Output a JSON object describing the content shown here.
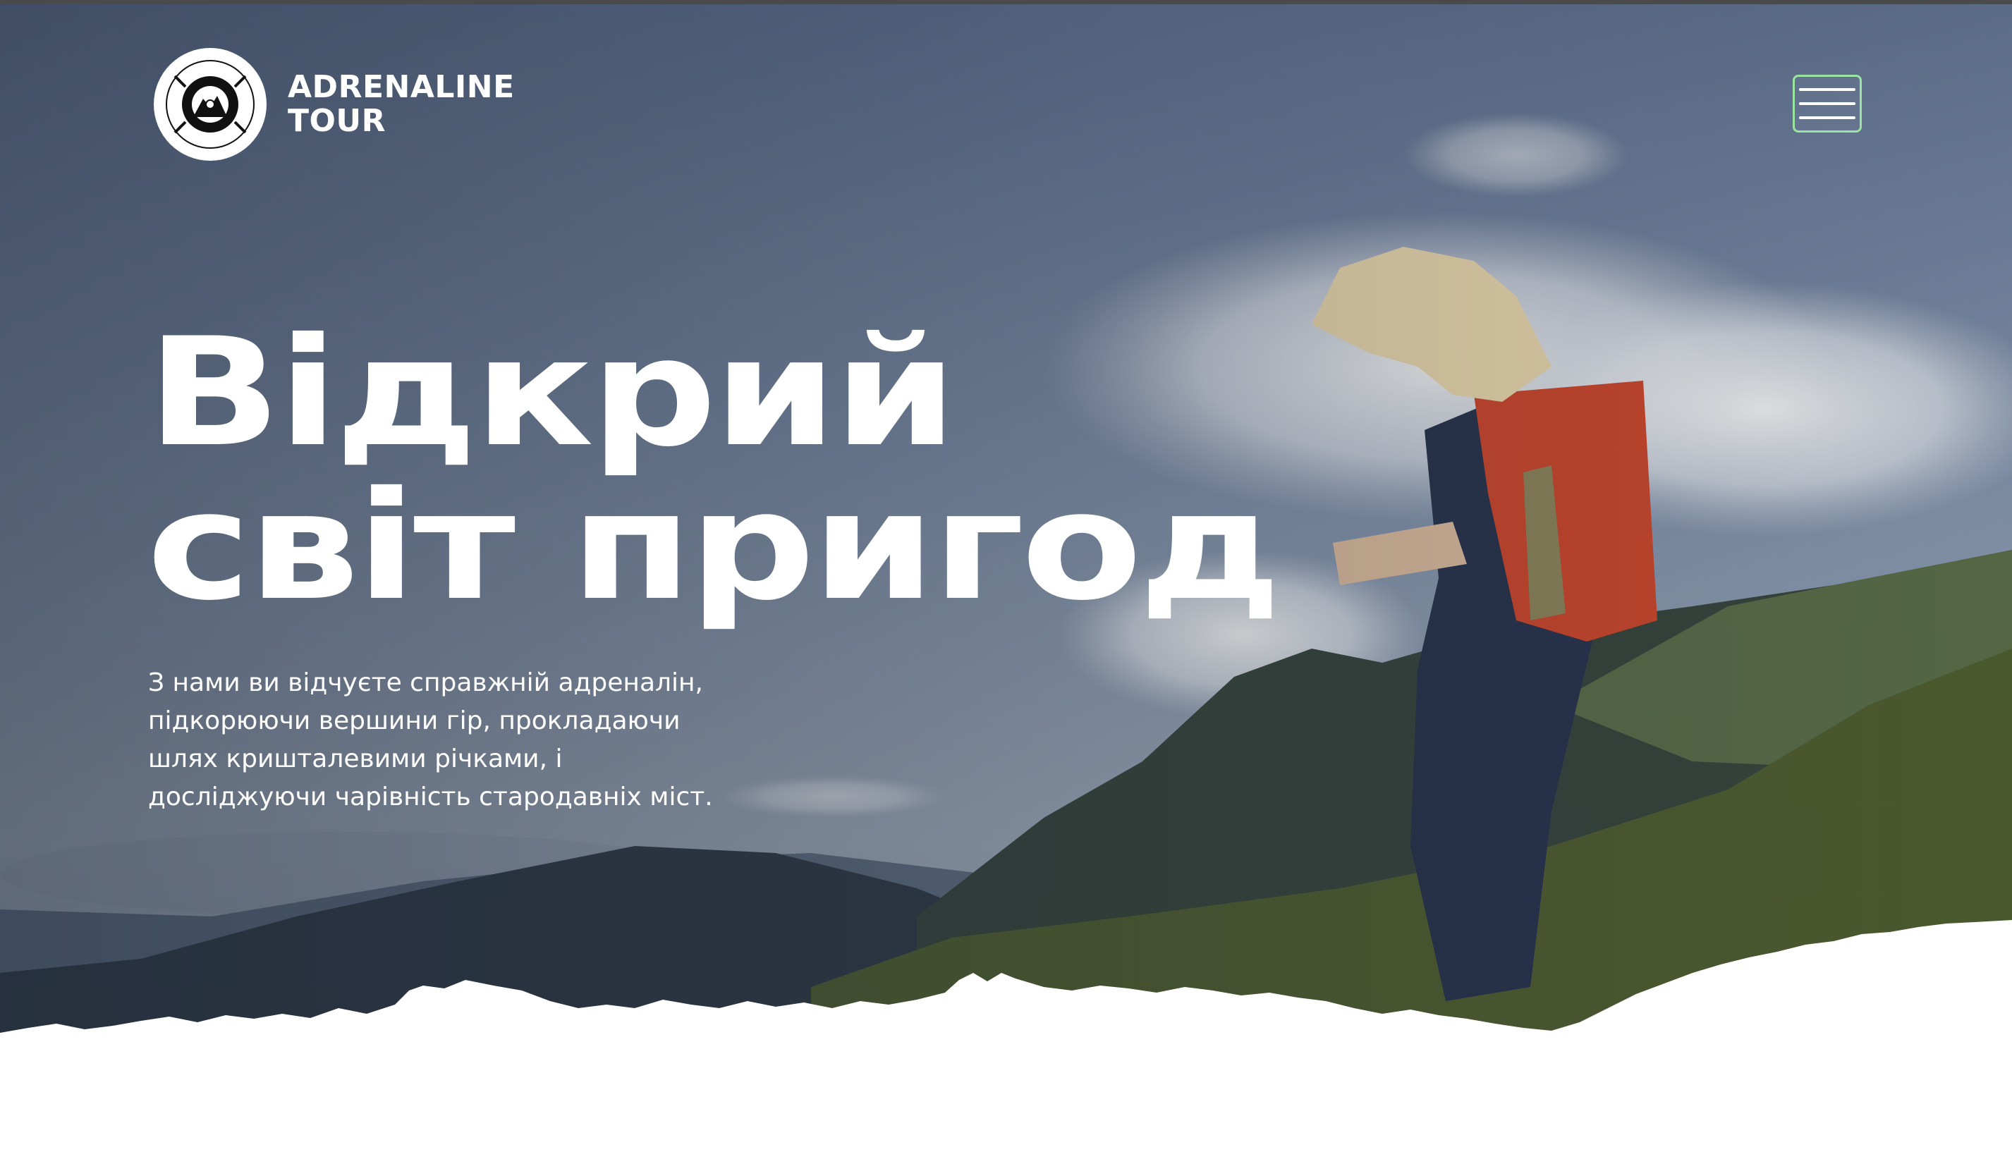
{
  "header": {
    "logo": {
      "badge_icon": "mountain-compass-logo-icon",
      "badge_ring_text": "ADRENALINE TOUR",
      "line1": "ADRENALINE",
      "line2": "TOUR"
    },
    "menu_icon": "hamburger-menu-icon",
    "menu_border_color": "#9be3a1"
  },
  "hero": {
    "title_line1": "Відкрий",
    "title_line2": "світ пригод",
    "description": "З нами ви відчуєте справжній адреналін, підкорюючи вершини гір, прокладаючи шлях кришталевими річками, і досліджуючи чарівність стародавніх міст."
  },
  "colors": {
    "text": "#ffffff",
    "overlay": "#2f3a4e",
    "sky": "#8d9db4",
    "backpack": "#c8452a",
    "grass": "#5d6b35"
  }
}
